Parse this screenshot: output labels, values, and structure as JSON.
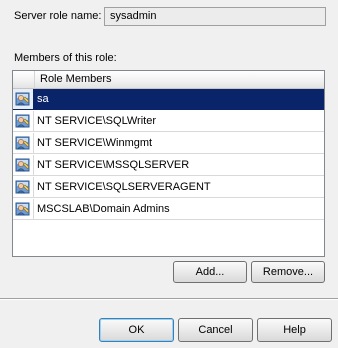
{
  "server_role": {
    "label": "Server role name:",
    "value": "sysadmin"
  },
  "members": {
    "label": "Members of this role:",
    "column_header": "Role Members",
    "rows": [
      {
        "name": "sa",
        "selected": true
      },
      {
        "name": "NT SERVICE\\SQLWriter",
        "selected": false
      },
      {
        "name": "NT SERVICE\\Winmgmt",
        "selected": false
      },
      {
        "name": "NT SERVICE\\MSSQLSERVER",
        "selected": false
      },
      {
        "name": "NT SERVICE\\SQLSERVERAGENT",
        "selected": false
      },
      {
        "name": "MSCSLAB\\Domain Admins",
        "selected": false
      }
    ],
    "row_icon": "user-login-icon"
  },
  "actions": {
    "add_label": "Add...",
    "remove_label": "Remove..."
  },
  "dialog_buttons": {
    "ok_label": "OK",
    "cancel_label": "Cancel",
    "help_label": "Help"
  },
  "colors": {
    "selection": "#0a246a",
    "window_bg": "#f0f0f0"
  }
}
